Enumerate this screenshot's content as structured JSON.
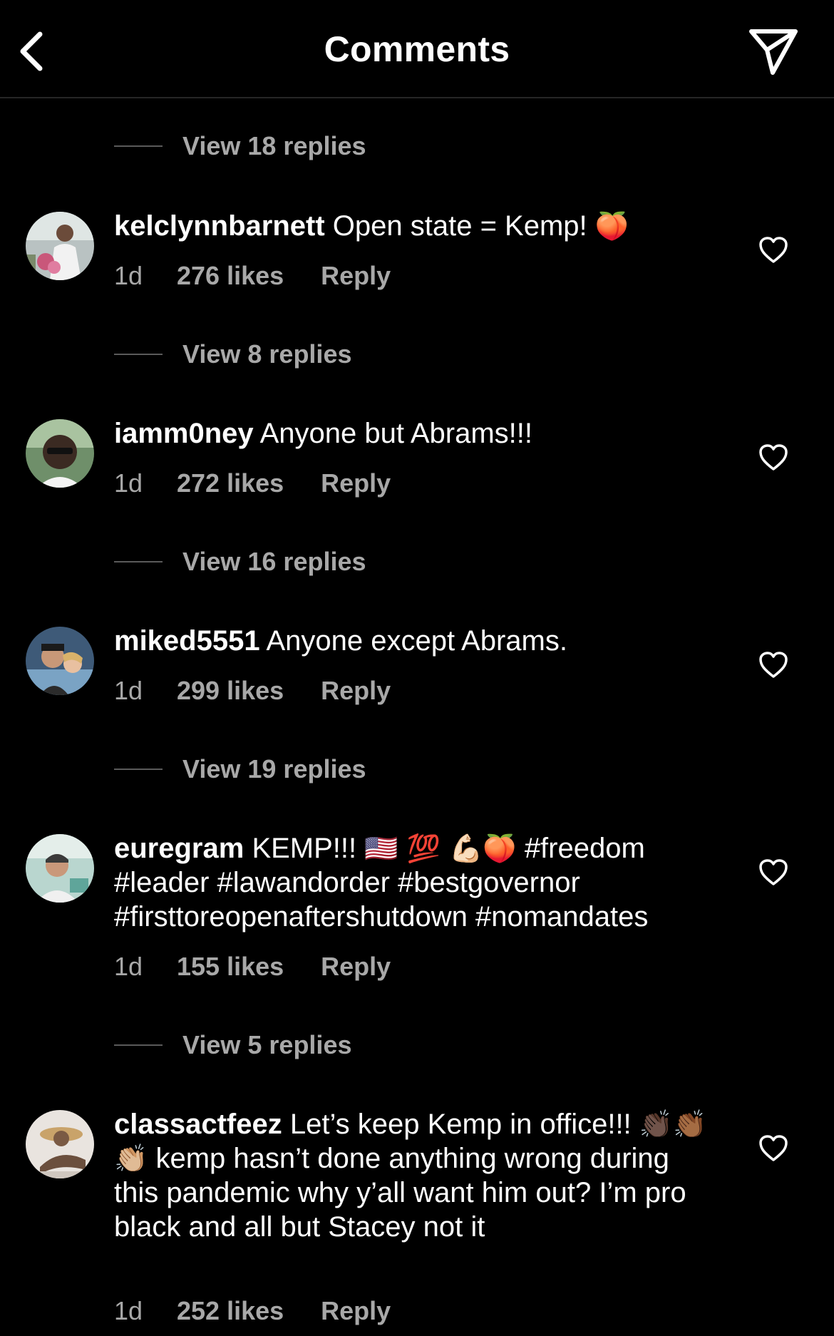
{
  "header": {
    "title": "Comments"
  },
  "view_replies": [
    "View 18 replies",
    "View 8 replies",
    "View 16 replies",
    "View 19 replies",
    "View 5 replies"
  ],
  "comments": [
    {
      "username": "kelclynnbarnett",
      "text": "Open state = Kemp!",
      "emoji": "🍑",
      "age": "1d",
      "likes": "276 likes",
      "reply": "Reply"
    },
    {
      "username": "iamm0ney",
      "text": "Anyone but Abrams!!!",
      "age": "1d",
      "likes": "272 likes",
      "reply": "Reply"
    },
    {
      "username": "miked5551",
      "text": "Anyone except Abrams.",
      "age": "1d",
      "likes": "299 likes",
      "reply": "Reply"
    },
    {
      "username": "euregram",
      "text_start": "KEMP!!!",
      "emoji": "🇺🇸 💯 💪🏻🍑",
      "text_end": "#freedom #leader #lawandorder #bestgovernor #firsttoreopenaftershutdown #nomandates",
      "age": "1d",
      "likes": "155 likes",
      "reply": "Reply"
    },
    {
      "username": "classactfeez",
      "text_start": "Let’s keep Kemp in office!!!",
      "emoji": "👏🏿👏🏾👏🏼",
      "text_end": "kemp hasn’t done anything wrong during this pandemic why y’all want him out?  I’m pro black and all but Stacey not it",
      "age": "1d",
      "likes": "252 likes",
      "reply": "Reply"
    }
  ],
  "colors": {
    "background": "#000000",
    "text": "#ffffff",
    "secondary": "#a8a8a8",
    "divider": "#262626"
  },
  "icons": [
    "back-arrow-icon",
    "send-icon",
    "heart-icon"
  ]
}
